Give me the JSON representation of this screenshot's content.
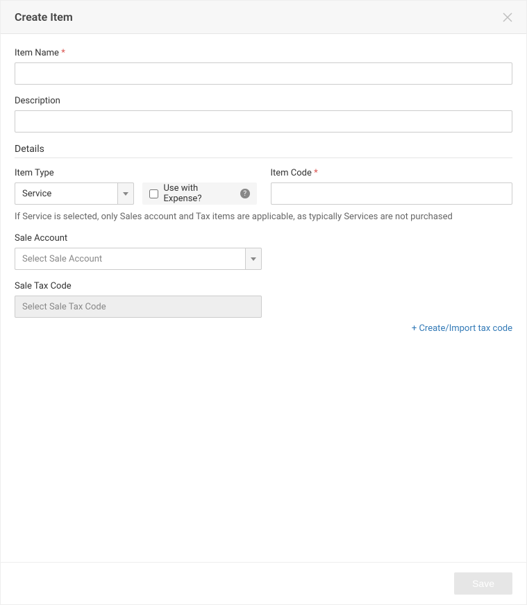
{
  "header": {
    "title": "Create Item"
  },
  "fields": {
    "item_name": {
      "label": "Item Name",
      "required": "*",
      "value": ""
    },
    "description": {
      "label": "Description",
      "value": ""
    },
    "details_header": "Details",
    "item_type": {
      "label": "Item Type",
      "selected": "Service"
    },
    "use_with_expense": {
      "label": "Use with Expense?",
      "checked": false
    },
    "item_code": {
      "label": "Item Code",
      "required": "*",
      "value": ""
    },
    "service_hint": "If Service is selected, only Sales account and Tax items are applicable, as typically Services are not purchased",
    "sale_account": {
      "label": "Sale Account",
      "placeholder": "Select Sale Account"
    },
    "sale_tax_code": {
      "label": "Sale Tax Code",
      "placeholder": "Select Sale Tax Code"
    },
    "create_import_link": "+ Create/Import tax code"
  },
  "footer": {
    "save_label": "Save"
  }
}
